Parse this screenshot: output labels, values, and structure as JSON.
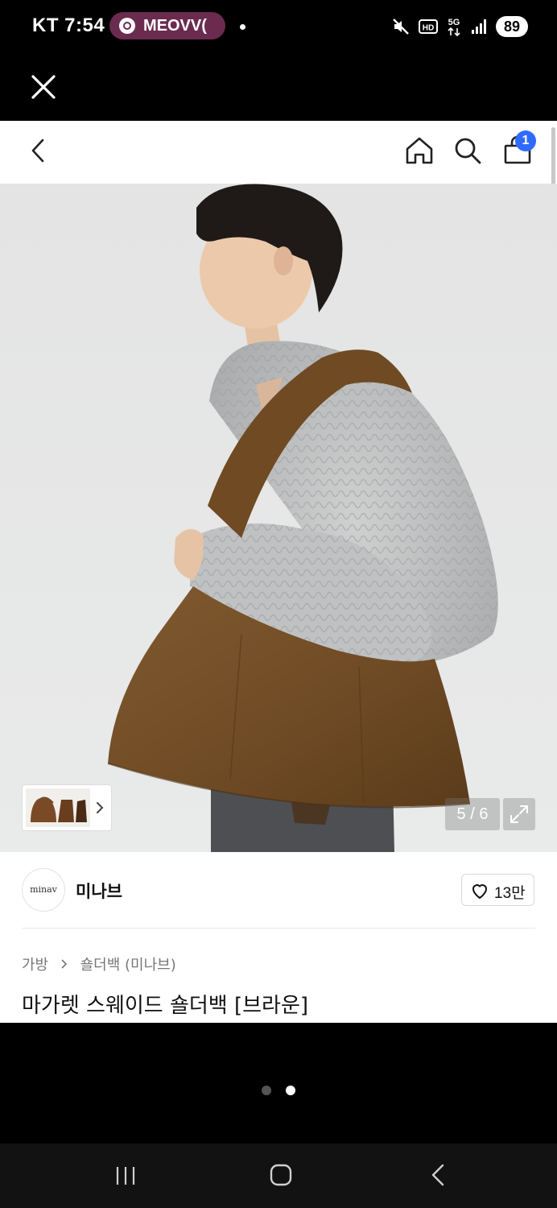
{
  "status_bar": {
    "carrier": "KT",
    "time": "7:54",
    "notification_pill": "MEOVV(",
    "battery": "89",
    "icons": [
      "mute-icon",
      "hd-icon",
      "5g-icon",
      "signal-icon",
      "battery-icon"
    ]
  },
  "overlay": {
    "close_icon": "close-icon"
  },
  "navbar": {
    "icons": [
      "back-icon",
      "home-icon",
      "search-icon",
      "shopping-bag-icon"
    ],
    "cart_count": "1"
  },
  "gallery": {
    "counter": "5 / 6",
    "current": 5,
    "total": 6,
    "expand_icon": "expand-icon"
  },
  "brand": {
    "logo_text": "minav",
    "name": "미나브",
    "likes": "13만"
  },
  "breadcrumb": {
    "category": "가방",
    "subcategory": "숄더백 (미나브)"
  },
  "product": {
    "title": "마가렛 스웨이드 숄더백 [브라운]"
  },
  "pager": {
    "pages": 2,
    "active": 2
  },
  "system_nav": {
    "icons": [
      "recents-icon",
      "home-button-icon",
      "back-button-icon"
    ]
  },
  "colors": {
    "accent_badge": "#2f6bff",
    "pill_bg": "#6b2b4f",
    "bag_brown": "#7a5129"
  }
}
